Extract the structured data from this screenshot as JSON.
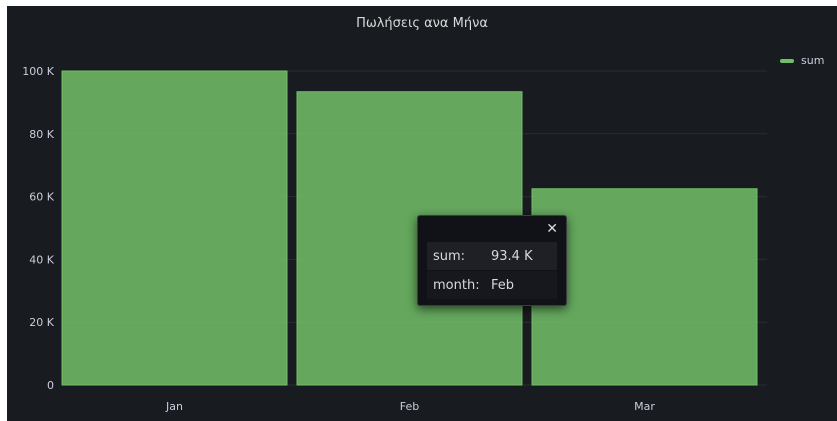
{
  "panel": {
    "title": "Πωλήσεις ανα Μήνα"
  },
  "legend": {
    "items": [
      {
        "label": "sum",
        "color": "#73bf69"
      }
    ]
  },
  "tooltip": {
    "close_icon": "close-icon",
    "rows": [
      {
        "key": "sum:",
        "value": "93.4 K"
      },
      {
        "key": "month:",
        "value": "Feb"
      }
    ]
  },
  "chart_data": {
    "type": "bar",
    "title": "Πωλήσεις ανα Μήνα",
    "categories": [
      "Jan",
      "Feb",
      "Mar"
    ],
    "series": [
      {
        "name": "sum",
        "values": [
          100000,
          93400,
          62500
        ],
        "color": "#73bf69"
      }
    ],
    "yticks": [
      "0",
      "20 K",
      "40 K",
      "60 K",
      "80 K",
      "100 K"
    ],
    "ylim": [
      0,
      100000
    ],
    "grid": true,
    "legend_placement": "right"
  }
}
